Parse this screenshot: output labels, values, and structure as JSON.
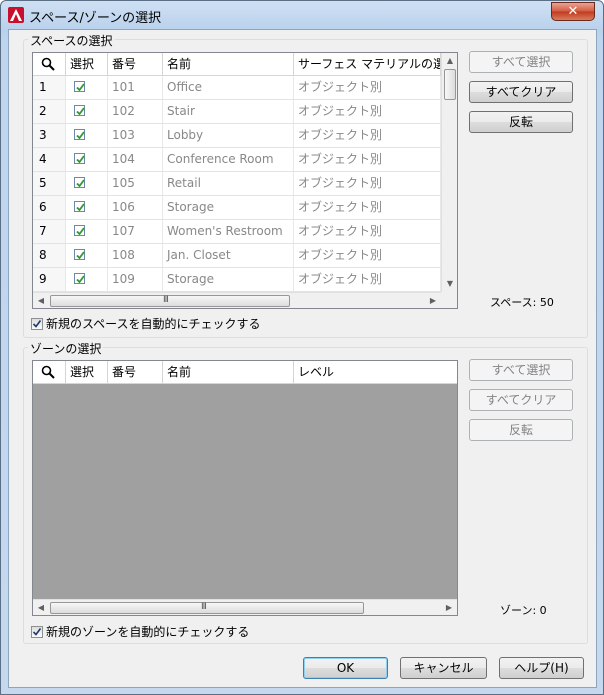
{
  "window": {
    "title": "スペース/ゾーンの選択",
    "close_glyph": "✕"
  },
  "spaces": {
    "group_label": "スペースの選択",
    "columns": [
      "",
      "選択",
      "番号",
      "名前",
      "サーフェス マテリアルの選"
    ],
    "rows": [
      {
        "idx": "1",
        "number": "101",
        "name": "Office",
        "material": "オブジェクト別"
      },
      {
        "idx": "2",
        "number": "102",
        "name": "Stair",
        "material": "オブジェクト別"
      },
      {
        "idx": "3",
        "number": "103",
        "name": "Lobby",
        "material": "オブジェクト別"
      },
      {
        "idx": "4",
        "number": "104",
        "name": "Conference Room",
        "material": "オブジェクト別"
      },
      {
        "idx": "5",
        "number": "105",
        "name": "Retail",
        "material": "オブジェクト別"
      },
      {
        "idx": "6",
        "number": "106",
        "name": "Storage",
        "material": "オブジェクト別"
      },
      {
        "idx": "7",
        "number": "107",
        "name": "Women's Restroom",
        "material": "オブジェクト別"
      },
      {
        "idx": "8",
        "number": "108",
        "name": "Jan. Closet",
        "material": "オブジェクト別"
      },
      {
        "idx": "9",
        "number": "109",
        "name": "Storage",
        "material": "オブジェクト別"
      }
    ],
    "buttons": {
      "select_all": "すべて選択",
      "clear_all": "すべてクリア",
      "invert": "反転"
    },
    "count_label": "スペース: 50",
    "auto_check_label": "新規のスペースを自動的にチェックする"
  },
  "zones": {
    "group_label": "ゾーンの選択",
    "columns": [
      "",
      "選択",
      "番号",
      "名前",
      "レベル"
    ],
    "buttons": {
      "select_all": "すべて選択",
      "clear_all": "すべてクリア",
      "invert": "反転"
    },
    "count_label": "ゾーン: 0",
    "auto_check_label": "新規のゾーンを自動的にチェックする"
  },
  "footer": {
    "ok": "OK",
    "cancel": "キャンセル",
    "help": "ヘルプ(H)"
  },
  "scroll_glyphs": {
    "up": "▲",
    "down": "▼",
    "left": "◀",
    "right": "▶",
    "grip": "III"
  },
  "colors": {
    "accent": "#3c7fb1",
    "check": "#2e9a2e",
    "grid_empty": "#a0a0a0"
  }
}
